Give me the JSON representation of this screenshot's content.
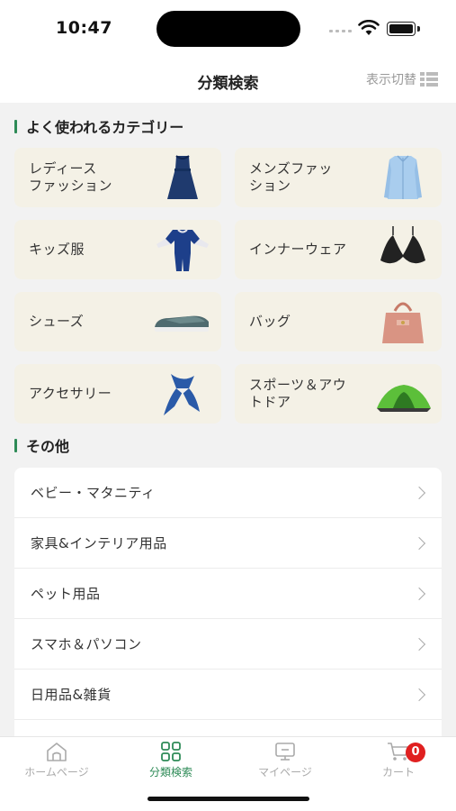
{
  "status_bar": {
    "time": "10:47"
  },
  "header": {
    "title": "分類検索",
    "view_toggle_label": "表示切替"
  },
  "sections": {
    "popular_title": "よく使われるカテゴリー",
    "other_title": "その他"
  },
  "categories": [
    {
      "label": "レディース\nファッション",
      "icon": "dress-icon"
    },
    {
      "label": "メンズファッ\nション",
      "icon": "shirt-icon"
    },
    {
      "label": "キッズ服",
      "icon": "kids-romper-icon"
    },
    {
      "label": "インナーウェア",
      "icon": "bra-icon"
    },
    {
      "label": "シューズ",
      "icon": "shoe-icon"
    },
    {
      "label": "バッグ",
      "icon": "handbag-icon"
    },
    {
      "label": "アクセサリー",
      "icon": "scarf-icon"
    },
    {
      "label": "スポーツ＆アウ\nトドア",
      "icon": "tent-icon"
    }
  ],
  "other_items": [
    {
      "label": "ベビー・マタニティ"
    },
    {
      "label": "家具&インテリア用品"
    },
    {
      "label": "ペット用品"
    },
    {
      "label": "スマホ＆パソコン"
    },
    {
      "label": "日用品&雑貨"
    }
  ],
  "tabs": [
    {
      "label": "ホームページ",
      "icon": "home-icon"
    },
    {
      "label": "分類検索",
      "icon": "grid-icon",
      "active": true
    },
    {
      "label": "マイページ",
      "icon": "profile-icon"
    },
    {
      "label": "カート",
      "icon": "cart-icon",
      "badge": "0"
    }
  ],
  "colors": {
    "accent": "#2e8b57",
    "card_bg": "#f4f1e6",
    "badge": "#e02020"
  }
}
